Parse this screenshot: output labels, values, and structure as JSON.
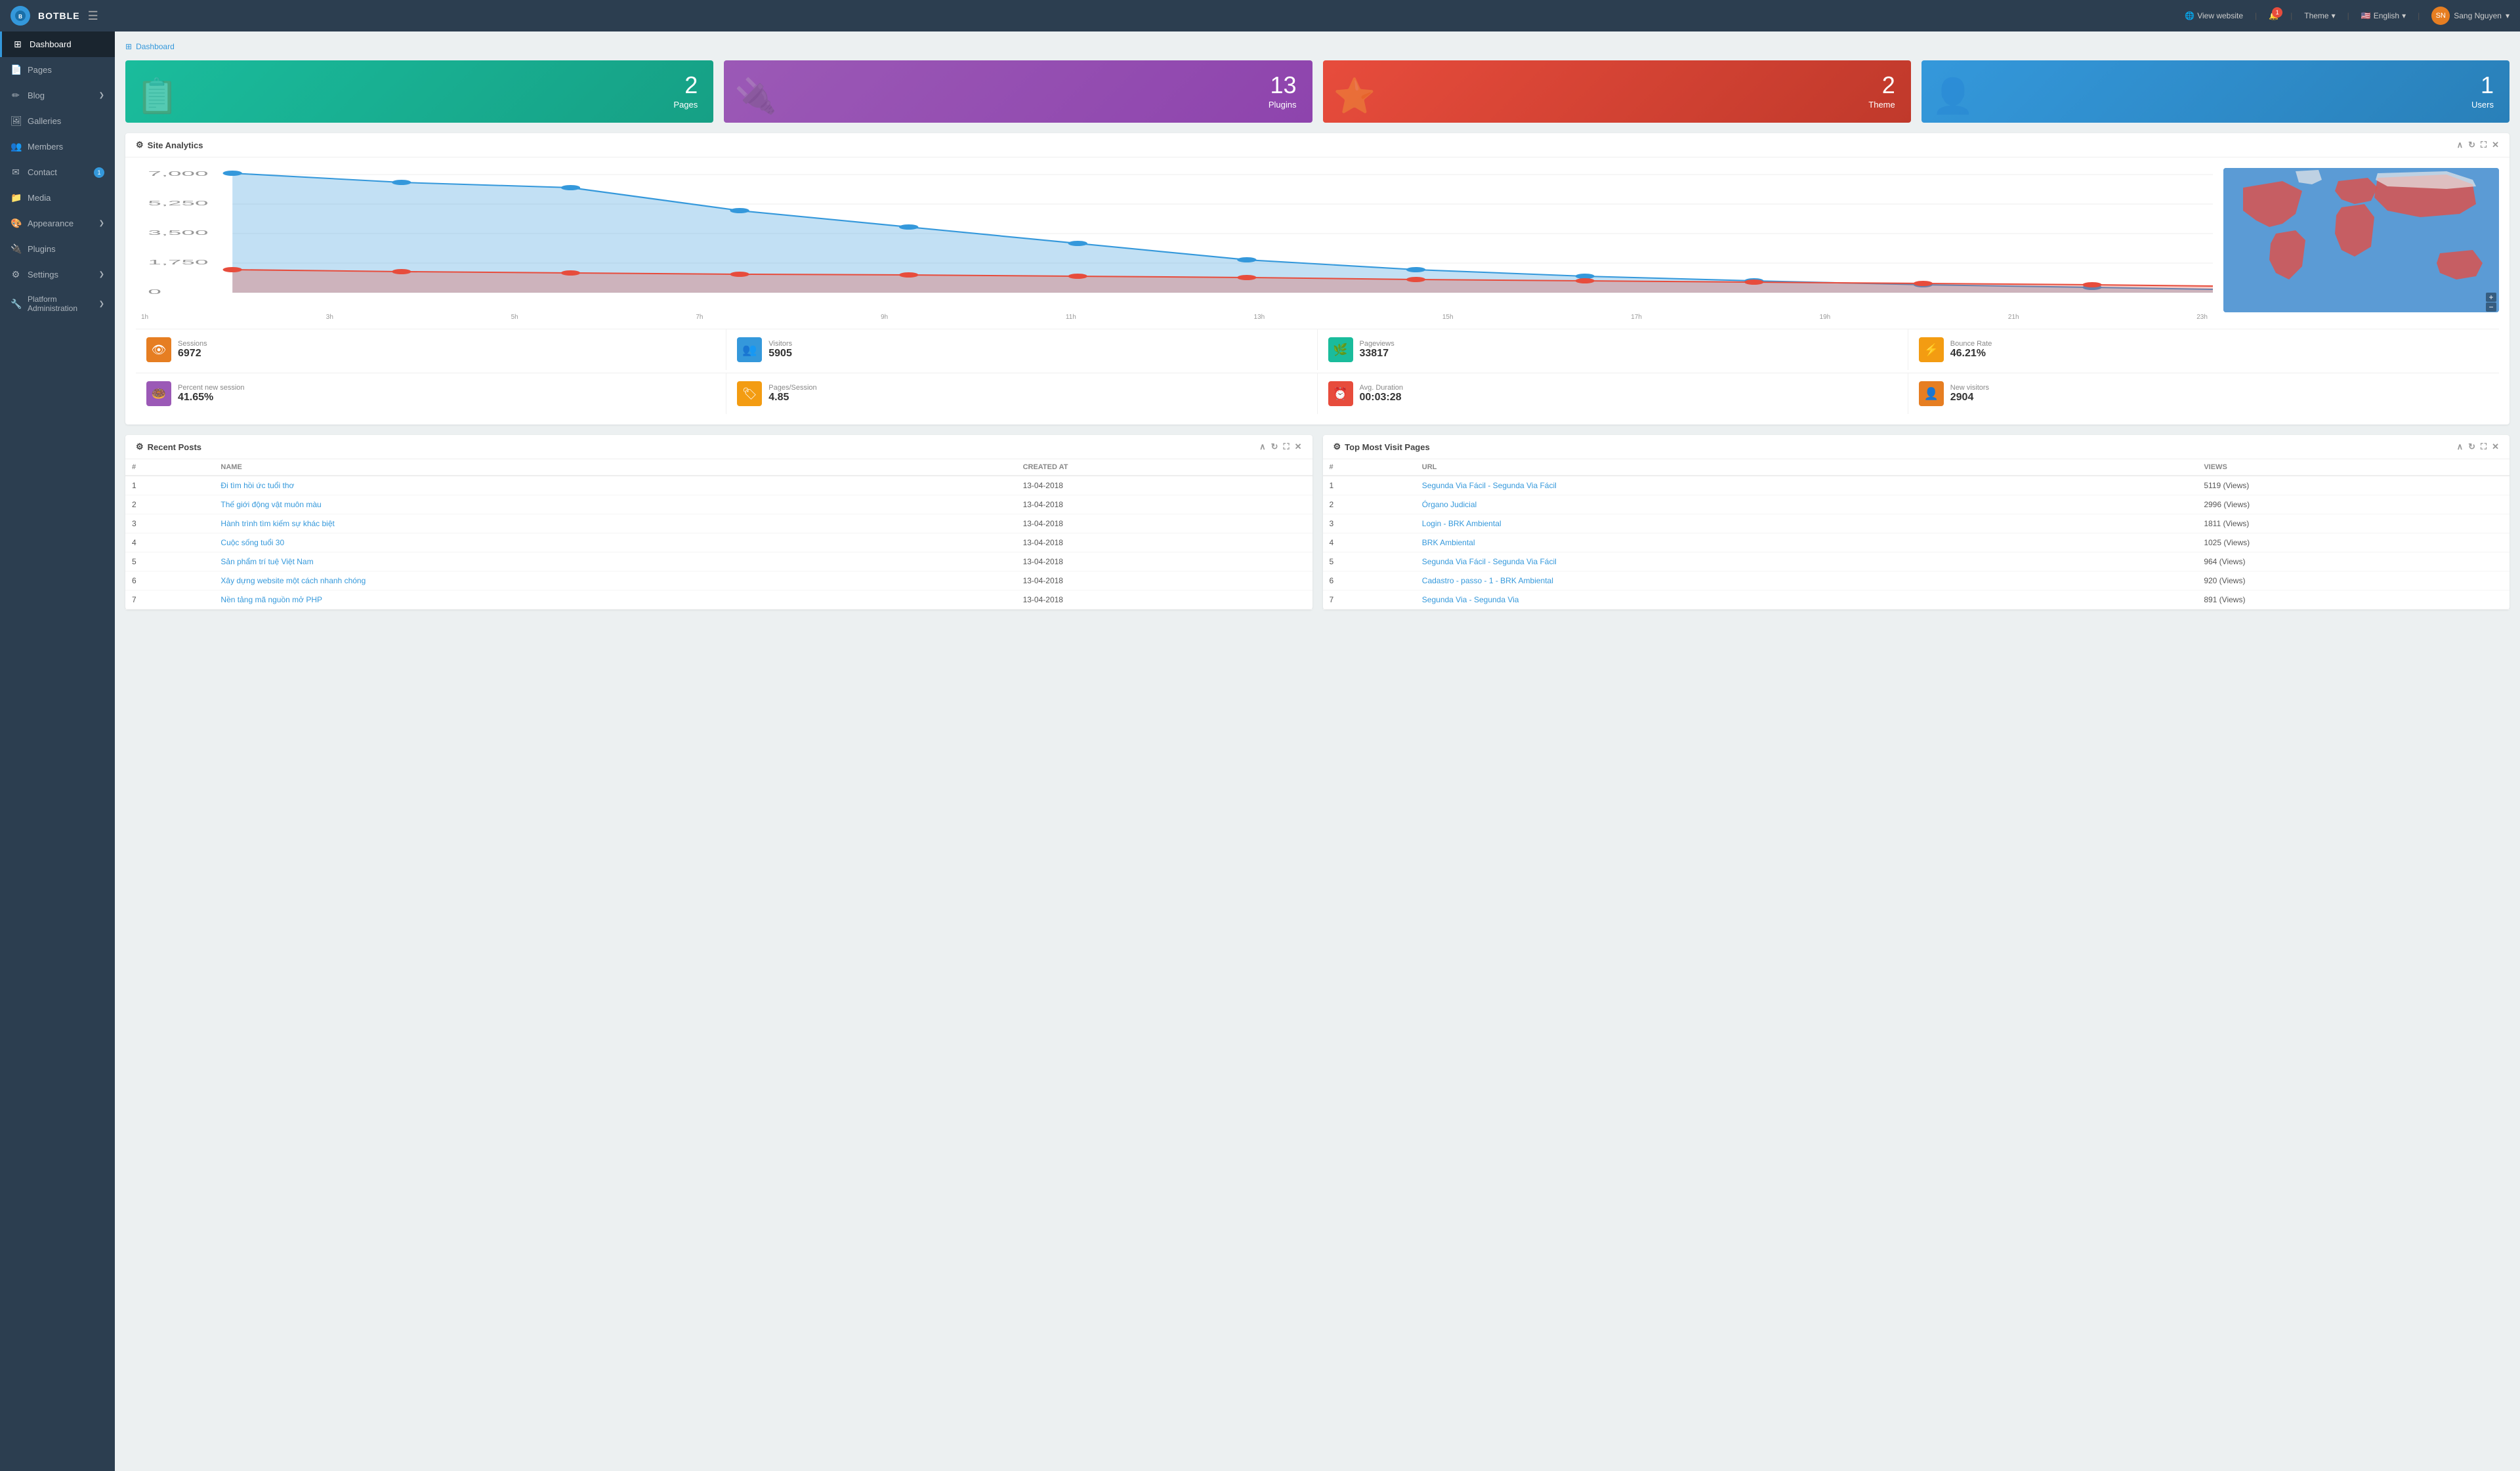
{
  "topnav": {
    "logo_text": "BOTBLE",
    "view_website": "View website",
    "theme_label": "Theme",
    "language_label": "English",
    "user_name": "Sang Nguyen",
    "notification_count": "1"
  },
  "sidebar": {
    "items": [
      {
        "id": "dashboard",
        "label": "Dashboard",
        "icon": "⊞",
        "active": true
      },
      {
        "id": "pages",
        "label": "Pages",
        "icon": "📄",
        "active": false
      },
      {
        "id": "blog",
        "label": "Blog",
        "icon": "✏️",
        "arrow": "❯",
        "active": false
      },
      {
        "id": "galleries",
        "label": "Galleries",
        "icon": "🖼",
        "active": false
      },
      {
        "id": "members",
        "label": "Members",
        "icon": "👥",
        "active": false
      },
      {
        "id": "contact",
        "label": "Contact",
        "icon": "✉",
        "badge": "1",
        "active": false
      },
      {
        "id": "media",
        "label": "Media",
        "icon": "📁",
        "active": false
      },
      {
        "id": "appearance",
        "label": "Appearance",
        "icon": "🎨",
        "arrow": "❯",
        "active": false
      },
      {
        "id": "plugins",
        "label": "Plugins",
        "icon": "🔌",
        "active": false
      },
      {
        "id": "settings",
        "label": "Settings",
        "icon": "⚙",
        "arrow": "❯",
        "active": false
      },
      {
        "id": "platform-admin",
        "label": "Platform Administration",
        "icon": "🔧",
        "arrow": "❯",
        "active": false
      }
    ]
  },
  "breadcrumb": {
    "icon": "⊞",
    "label": "Dashboard"
  },
  "stat_cards": [
    {
      "id": "pages",
      "num": "2",
      "label": "Pages",
      "icon": "📄",
      "color": "card-teal"
    },
    {
      "id": "plugins",
      "num": "13",
      "label": "Plugins",
      "icon": "🔌",
      "color": "card-purple"
    },
    {
      "id": "theme",
      "num": "2",
      "label": "Theme",
      "icon": "⭐",
      "color": "card-red"
    },
    {
      "id": "users",
      "num": "1",
      "label": "Users",
      "icon": "👤",
      "color": "card-blue"
    }
  ],
  "analytics": {
    "title": "Site Analytics",
    "x_axis": [
      "1h",
      "3h",
      "5h",
      "7h",
      "9h",
      "11h",
      "13h",
      "15h",
      "17h",
      "19h",
      "21h",
      "23h"
    ],
    "y_axis": [
      "7,000",
      "5,250",
      "3,500",
      "1,750",
      "0"
    ]
  },
  "stats": [
    {
      "id": "sessions",
      "label": "Sessions",
      "value": "6972",
      "icon": "👁",
      "icon_class": "icon-orange"
    },
    {
      "id": "visitors",
      "label": "Visitors",
      "value": "5905",
      "icon": "👥",
      "icon_class": "icon-blue"
    },
    {
      "id": "pageviews",
      "label": "Pageviews",
      "value": "33817",
      "icon": "🌿",
      "icon_class": "icon-teal"
    },
    {
      "id": "bounce-rate",
      "label": "Bounce Rate",
      "value": "46.21%",
      "icon": "⚡",
      "icon_class": "icon-yellow"
    },
    {
      "id": "percent-new-session",
      "label": "Percent new session",
      "value": "41.65%",
      "icon": "🍩",
      "icon_class": "icon-purple"
    },
    {
      "id": "pages-session",
      "label": "Pages/Session",
      "value": "4.85",
      "icon": "🏷",
      "icon_class": "icon-amber"
    },
    {
      "id": "avg-duration",
      "label": "Avg. Duration",
      "value": "00:03:28",
      "icon": "⏰",
      "icon_class": "icon-red"
    },
    {
      "id": "new-visitors",
      "label": "New visitors",
      "value": "2904",
      "icon": "👤+",
      "icon_class": "icon-orange"
    }
  ],
  "recent_posts": {
    "title": "Recent Posts",
    "columns": [
      "#",
      "NAME",
      "CREATED AT"
    ],
    "rows": [
      {
        "num": "1",
        "name": "Đi tìm hồi ức tuổi thơ",
        "date": "13-04-2018"
      },
      {
        "num": "2",
        "name": "Thế giới động vật muôn màu",
        "date": "13-04-2018"
      },
      {
        "num": "3",
        "name": "Hành trình tìm kiếm sự khác biệt",
        "date": "13-04-2018"
      },
      {
        "num": "4",
        "name": "Cuộc sống tuổi 30",
        "date": "13-04-2018"
      },
      {
        "num": "5",
        "name": "Sản phẩm trí tuệ Việt Nam",
        "date": "13-04-2018"
      },
      {
        "num": "6",
        "name": "Xây dựng website một cách nhanh chóng",
        "date": "13-04-2018"
      },
      {
        "num": "7",
        "name": "Nền tảng mã nguồn mở PHP",
        "date": "13-04-2018"
      }
    ]
  },
  "top_pages": {
    "title": "Top Most Visit Pages",
    "columns": [
      "#",
      "URL",
      "VIEWS"
    ],
    "rows": [
      {
        "num": "1",
        "url": "Segunda Via Fácil - Segunda Via Fácil",
        "views": "5119 (Views)"
      },
      {
        "num": "2",
        "url": "Órgano Judicial",
        "views": "2996 (Views)"
      },
      {
        "num": "3",
        "url": "Login - BRK Ambiental",
        "views": "1811 (Views)"
      },
      {
        "num": "4",
        "url": "BRK Ambiental",
        "views": "1025 (Views)"
      },
      {
        "num": "5",
        "url": "Segunda Via Fácil - Segunda Via Fácil",
        "views": "964 (Views)"
      },
      {
        "num": "6",
        "url": "Cadastro - passo - 1 - BRK Ambiental",
        "views": "920 (Views)"
      },
      {
        "num": "7",
        "url": "Segunda Via - Segunda Via",
        "views": "891 (Views)"
      }
    ]
  }
}
